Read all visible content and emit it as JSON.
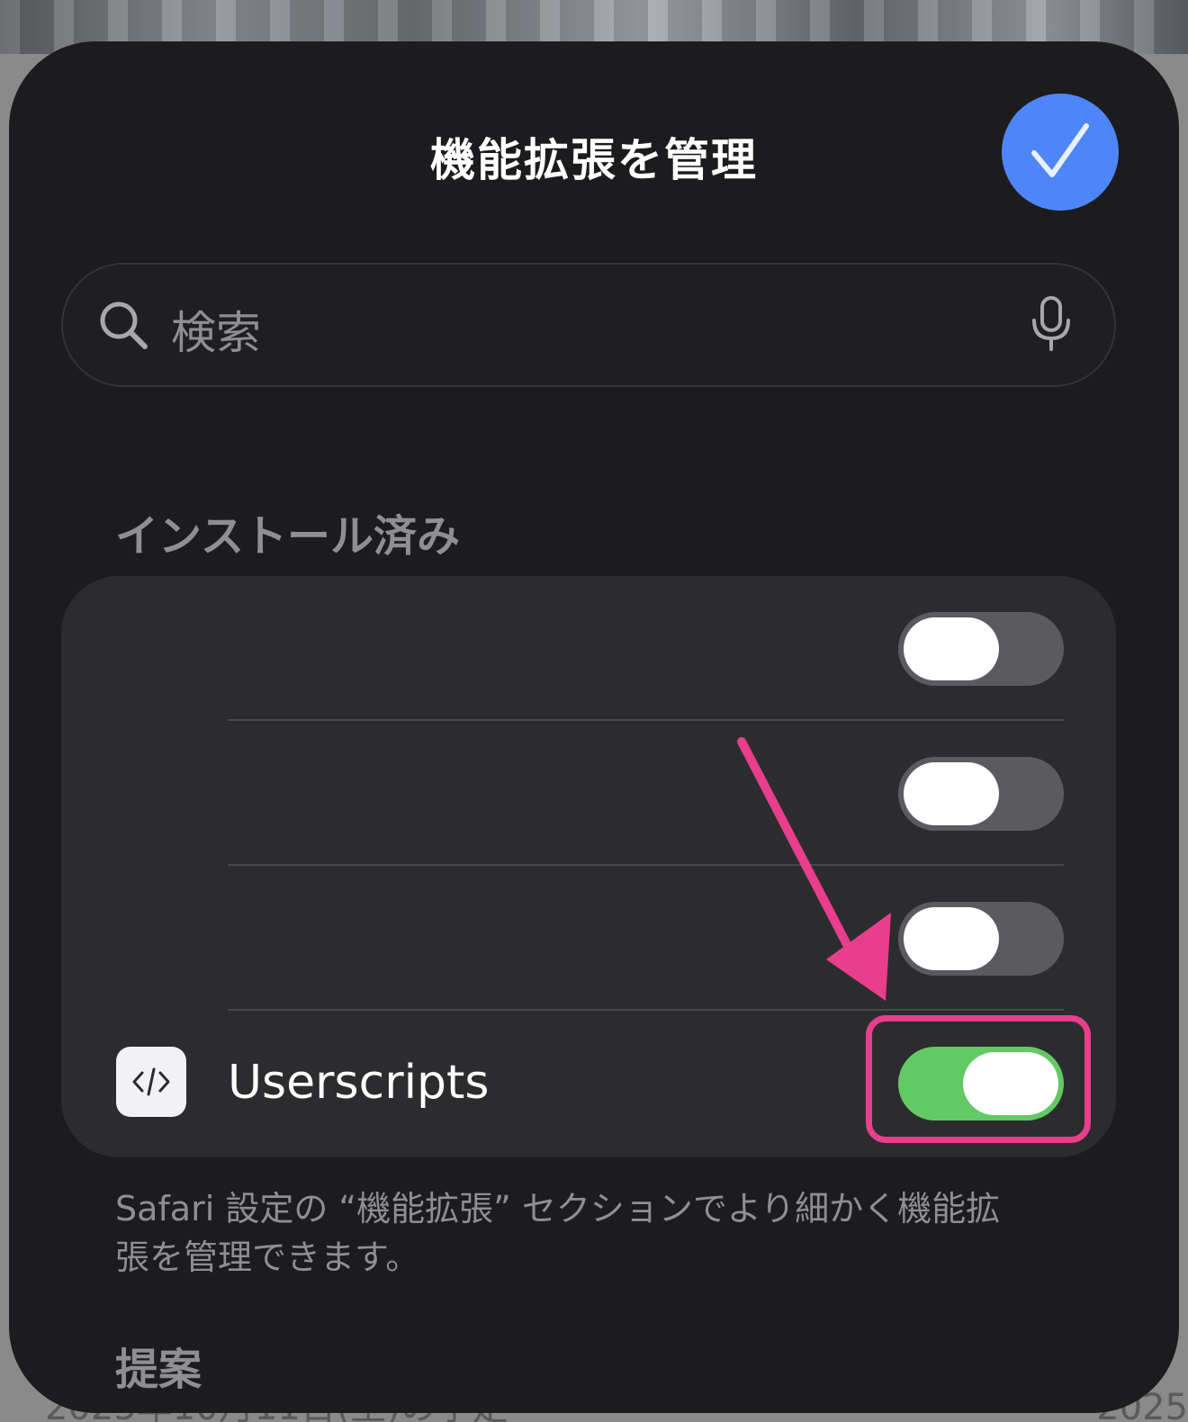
{
  "sheet": {
    "title": "機能拡張を管理",
    "done_icon": "checkmark-icon"
  },
  "search": {
    "placeholder": "検索",
    "search_icon": "search-icon",
    "mic_icon": "microphone-icon"
  },
  "installed": {
    "header": "インストール済み",
    "items": [
      {
        "label": "",
        "enabled": false
      },
      {
        "label": "",
        "enabled": false
      },
      {
        "label": "",
        "enabled": false
      },
      {
        "label": "Userscripts",
        "enabled": true,
        "icon": "code-icon",
        "icon_text": "</>"
      }
    ],
    "footnote": "Safari 設定の “機能拡張” セクションでより細かく機能拡張を管理できます。"
  },
  "suggestions": {
    "header": "提案"
  },
  "backdrop": {
    "left_text": "2025年10月11日(土)の予定",
    "right_text": "2025"
  },
  "colors": {
    "sheet_bg": "#1c1c1e",
    "group_bg": "#2c2c2e",
    "accent_blue": "#4f86f7",
    "toggle_on": "#63c965",
    "toggle_off": "#5b5b5f",
    "annotation": "#e83e8c"
  }
}
